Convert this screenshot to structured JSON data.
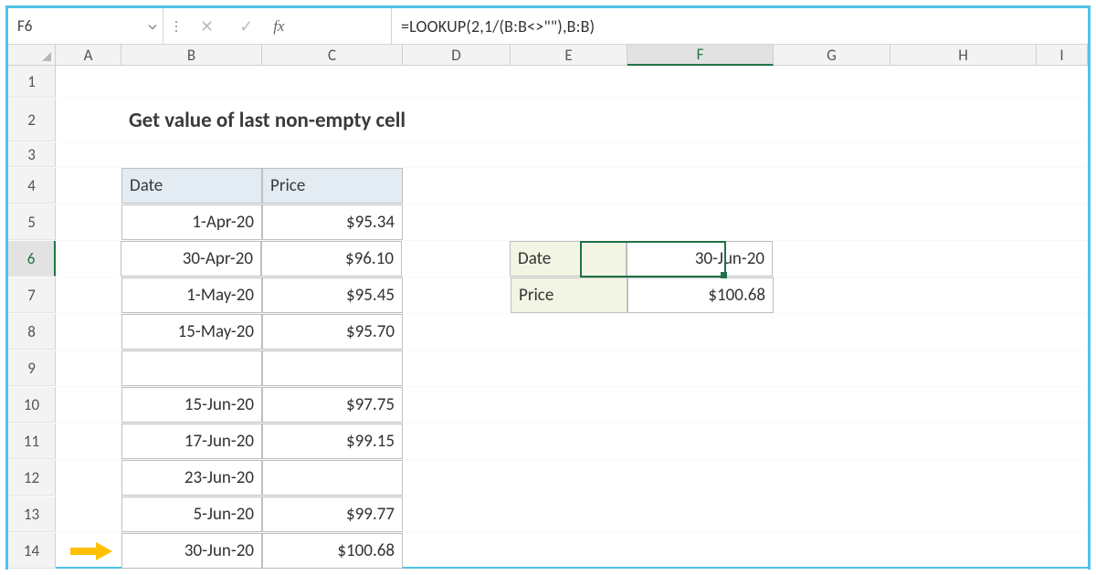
{
  "name_box": "F6",
  "formula": "=LOOKUP(2,1/(B:B<>\"\"),B:B)",
  "columns": [
    "A",
    "B",
    "C",
    "D",
    "E",
    "F",
    "G",
    "H",
    "I"
  ],
  "active_col": "F",
  "active_row": 6,
  "rows": [
    1,
    2,
    3,
    4,
    5,
    6,
    7,
    8,
    9,
    10,
    11,
    12,
    13,
    14
  ],
  "title": "Get value of last non-empty cell",
  "table_headers": {
    "b": "Date",
    "c": "Price"
  },
  "table_rows": [
    {
      "date": "1-Apr-20",
      "price": "$95.34"
    },
    {
      "date": "30-Apr-20",
      "price": "$96.10"
    },
    {
      "date": "1-May-20",
      "price": "$95.45"
    },
    {
      "date": "15-May-20",
      "price": "$95.70"
    },
    {
      "date": "",
      "price": ""
    },
    {
      "date": "15-Jun-20",
      "price": "$97.75"
    },
    {
      "date": "17-Jun-20",
      "price": "$99.15"
    },
    {
      "date": "23-Jun-20",
      "price": ""
    },
    {
      "date": "5-Jun-20",
      "price": "$99.77"
    },
    {
      "date": "30-Jun-20",
      "price": "$100.68"
    }
  ],
  "result": {
    "labels": {
      "date": "Date",
      "price": "Price"
    },
    "values": {
      "date": "30-Jun-20",
      "price": "$100.68"
    }
  },
  "colors": {
    "frame": "#4fc3e8",
    "header_bg": "#e3ecf2",
    "result_label_bg": "#f3f5e4",
    "selection": "#1f7246",
    "arrow": "#ffc000"
  }
}
